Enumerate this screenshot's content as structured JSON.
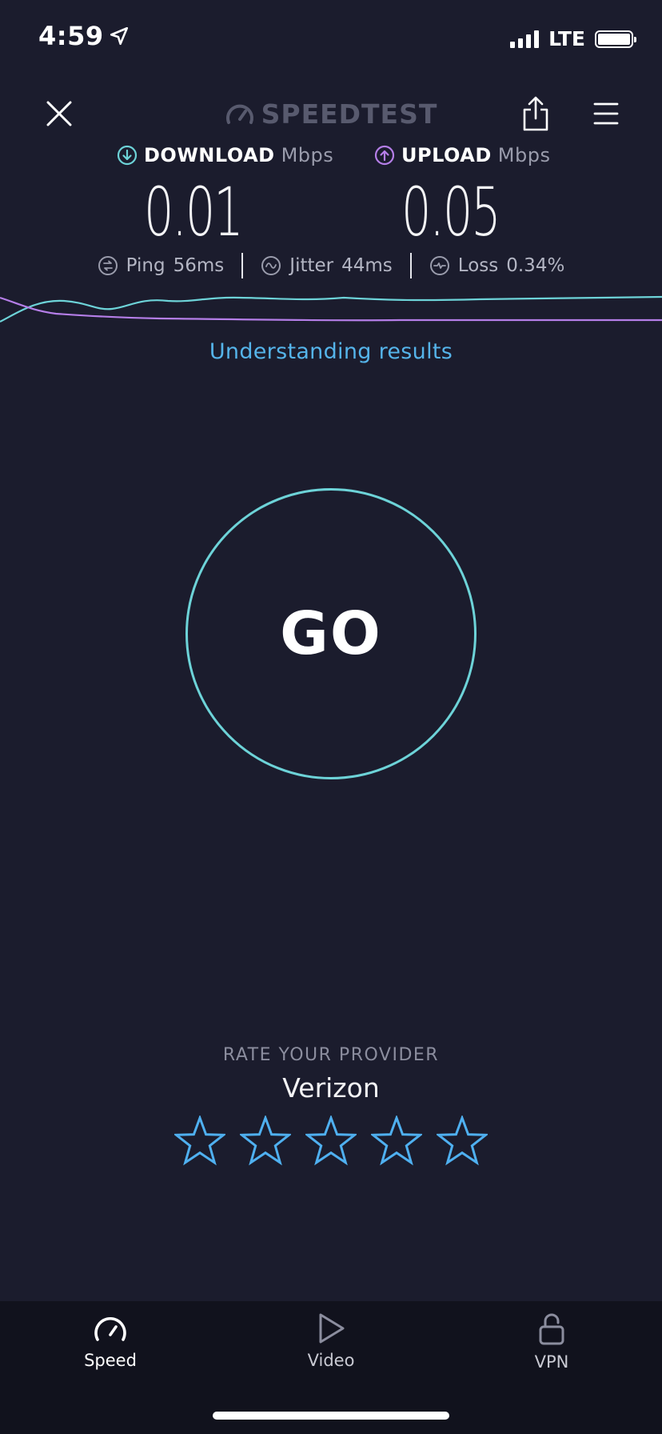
{
  "status_bar": {
    "time": "4:59",
    "network": "LTE",
    "battery_percent": 100
  },
  "header": {
    "brand": "SPEEDTEST"
  },
  "metrics": {
    "download": {
      "label": "DOWNLOAD",
      "unit": "Mbps",
      "value": "0.01",
      "color": "#6dd3d8"
    },
    "upload": {
      "label": "UPLOAD",
      "unit": "Mbps",
      "value": "0.05",
      "color": "#b57ee8"
    }
  },
  "stats": {
    "ping": {
      "label": "Ping",
      "value": "56",
      "unit": "ms"
    },
    "jitter": {
      "label": "Jitter",
      "value": "44",
      "unit": "ms"
    },
    "loss": {
      "label": "Loss",
      "value": "0.34",
      "unit": "%"
    }
  },
  "links": {
    "understanding": "Understanding results"
  },
  "go_button": {
    "label": "GO"
  },
  "rating": {
    "title": "RATE YOUR PROVIDER",
    "provider": "Verizon",
    "star_count": 5,
    "selected": 0
  },
  "tabs": [
    {
      "label": "Speed",
      "icon": "speedometer-icon",
      "active": true
    },
    {
      "label": "Video",
      "icon": "play-icon",
      "active": false
    },
    {
      "label": "VPN",
      "icon": "unlock-icon",
      "active": false
    }
  ],
  "colors": {
    "background": "#1b1c2d",
    "accent_teal": "#6dd3d8",
    "accent_purple": "#b57ee8",
    "link_blue": "#55b4ea",
    "star_blue": "#4fb0f0"
  }
}
